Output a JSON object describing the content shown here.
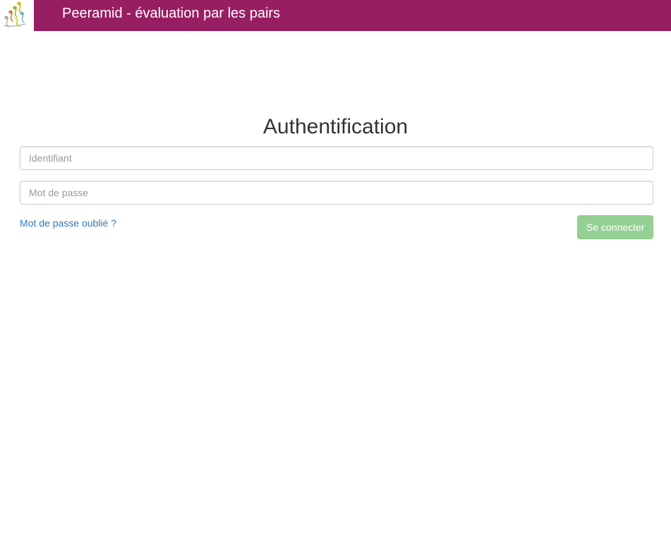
{
  "header": {
    "brand": "Peeramid - évaluation par les pairs",
    "logo_icon": "peeramid-logo-icon",
    "background_color": "#981e62"
  },
  "login": {
    "title": "Authentification",
    "username_placeholder": "Identifiant",
    "username_value": "",
    "password_placeholder": "Mot de passe",
    "password_value": "",
    "forgot_password_label": "Mot de passe oublié ?",
    "submit_label": "Se connecter",
    "submit_color": "#5cb85c",
    "link_color": "#337ab7"
  }
}
